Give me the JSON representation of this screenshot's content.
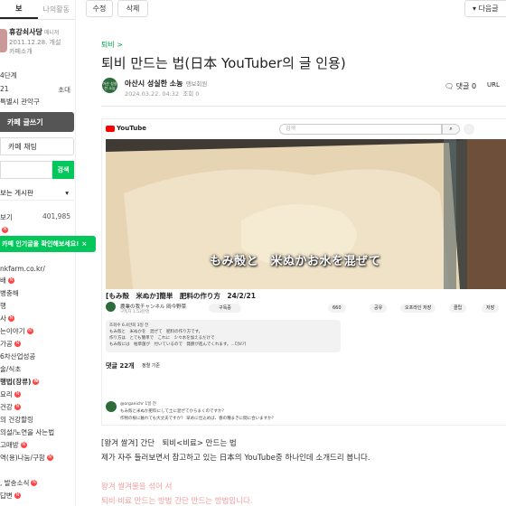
{
  "sidebar": {
    "tabs": [
      "보",
      "나의활동"
    ],
    "cafe_name": "휴강쇠사당",
    "cafe_badge": "매니저",
    "cafe_date": "2011.12.28. 개설",
    "cafe_intro": "카페소개",
    "lines": [
      {
        "left": "4단계",
        "right": ""
      },
      {
        "left": "21",
        "right": "초대"
      },
      {
        "left": "특별시 관악구",
        "right": ""
      }
    ],
    "write_label": "카페 글쓰기",
    "chat_label": "카페 채팅",
    "search_label": "검색",
    "board_select": "보는 게시판",
    "all_posts_label": "보기",
    "all_posts_count": "401,985",
    "url_text": "nkfarm.co.kr/",
    "menu": [
      {
        "label": "배",
        "new": true,
        "bold": false
      },
      {
        "label": "병충해",
        "new": false,
        "bold": false
      },
      {
        "label": "행",
        "new": false,
        "bold": false
      },
      {
        "label": "사",
        "new": true,
        "bold": false
      },
      {
        "label": "는이야기",
        "new": true,
        "bold": false
      },
      {
        "label": "가공",
        "new": true,
        "bold": false
      },
      {
        "label": "6차산업성공",
        "new": false,
        "bold": false
      },
      {
        "label": "술/식초",
        "new": false,
        "bold": false
      },
      {
        "label": "행법(장류)",
        "new": true,
        "bold": true
      },
      {
        "label": "요리",
        "new": true,
        "bold": false
      },
      {
        "label": "건강",
        "new": true,
        "bold": false
      },
      {
        "label": "의 건강할링",
        "new": false,
        "bold": false
      },
      {
        "label": "의설/노연을 사는법",
        "new": false,
        "bold": false
      },
      {
        "label": "고매방",
        "new": true,
        "bold": false
      },
      {
        "label": "역(용)나눔/구함",
        "new": true,
        "bold": false
      },
      {
        "label": "",
        "new": false,
        "bold": false
      },
      {
        "label": ", 발송소식",
        "new": true,
        "bold": false
      },
      {
        "label": "답변",
        "new": true,
        "bold": false
      }
    ],
    "menu_new_mark": "N"
  },
  "toast": {
    "text": "카페 인기글을 확인해보세요!",
    "close": "×"
  },
  "topbar": {
    "edit": "수정",
    "delete": "삭제",
    "next": "다음글"
  },
  "article": {
    "breadcrumb": "퇴비 >",
    "title": "퇴비 만드는 법(日本 YouTuber의 글 인용)",
    "author": "아산시 성실한 소농",
    "author_rank": "맹보회원",
    "author_avatar_text": "아산 성실한 소농",
    "date": "2024.03.22. 04:32",
    "views": "조회 0",
    "comment_label": "댓글 0",
    "url_label": "URL"
  },
  "youtube": {
    "logo": "YouTube",
    "search_placeholder": "검색",
    "caption": "もみ殻と　米ぬかお水を混ぜて",
    "video_title": "[もみ殻　米ぬか]簡単　肥料の作り方　24/2/21",
    "channel": "農業の我チャンネル 岡今野菜",
    "subs": "구독자 1.53만명",
    "subscribe": "구독중",
    "actions": [
      "660",
      "공유",
      "오프라인 저장",
      "클립",
      "저장"
    ],
    "desc_lines": [
      "조회수 6.4만회 3일 전",
      "もみ殻と　米ぬかを　混ぜて　肥料の作り方です。",
      "作り方は　とても簡単で　これに　少々水を加えるだけで",
      "もみ殻には　枯草菌が　付いているので　発酵が進んでくれます。...더보기"
    ],
    "comments_count": "댓글 22개",
    "sort_label": "정렬 기준",
    "comment_lines": [
      "@organichr 1일 전",
      "もみ殻と米ぬか肥料にして土に混ぜてからまくのですか？",
      "作物の根に触れても大丈夫ですか？ 早めに仕込めば、春の種まきに間に合いますか？"
    ]
  },
  "body": {
    "line1": "[왕겨 쌀겨] 간단　퇴비<비료> 만드는 법",
    "line2": "제가 자주 들러보면서 참고하고 있는 日本의 YouTube중 하나인데 소개드리 봅니다.",
    "line3": "왕겨 쌀겨물을 섞어 서",
    "line4": "퇴비·비료 만드는 방법 간단 만드는 방법입니다."
  }
}
